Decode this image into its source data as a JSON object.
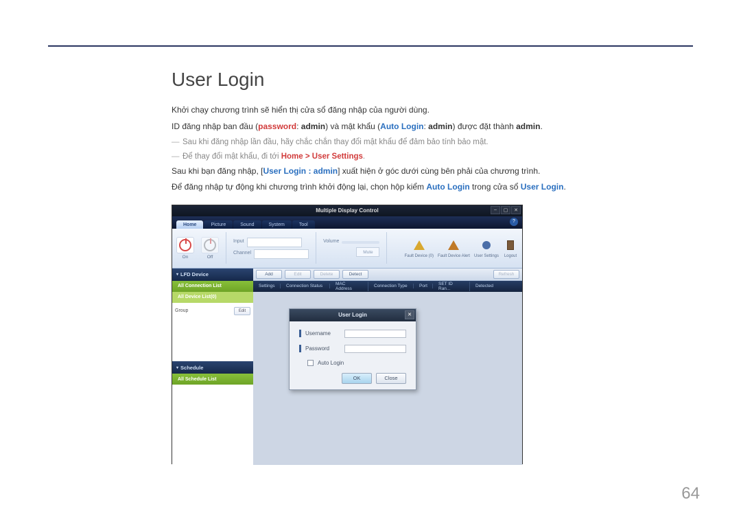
{
  "page_number": "64",
  "heading": "User Login",
  "para1": "Khởi chạy chương trình sẽ hiển thị cửa sổ đăng nhập của người dùng.",
  "para2_a": "ID đăng nhập ban đầu (",
  "para2_pw": "password",
  "para2_b": ": ",
  "para2_admin1": "admin",
  "para2_c": ") và mật khẩu (",
  "para2_al": "Auto Login",
  "para2_d": ": ",
  "para2_admin2": "admin",
  "para2_e": ") được đặt thành ",
  "para2_admin3": "admin",
  "para2_f": ".",
  "note1": "Sau khi đăng nhập lần đầu, hãy chắc chắn thay đổi mật khẩu để đảm bảo tính bảo mật.",
  "note2_a": "Để thay đổi mật khẩu, đi tới ",
  "note2_home": "Home",
  "note2_sep": " > ",
  "note2_us": "User Settings",
  "note2_end": ".",
  "para3_a": "Sau khi bạn đăng nhập, [",
  "para3_login": "User Login : admin",
  "para3_b": "] xuất hiện ở góc dưới cùng bên phải của chương trình.",
  "para4_a": "Để đăng nhập tự động khi chương trình khởi động lại, chọn hộp kiểm ",
  "para4_al": "Auto Login",
  "para4_b": " trong cửa sổ ",
  "para4_ul": "User Login",
  "para4_c": ".",
  "app": {
    "title": "Multiple Display Control",
    "tabs": [
      "Home",
      "Picture",
      "Sound",
      "System",
      "Tool"
    ],
    "ribbon": {
      "on": "On",
      "off": "Off",
      "input": "Input",
      "channel": "Channel",
      "volume": "Volume",
      "mute": "Mute",
      "fault_device": "Fault Device (0)",
      "fault_alert": "Fault Device Alert",
      "user_settings": "User Settings",
      "logout": "Logout"
    },
    "sidebar": {
      "lfd": "LFD Device",
      "conn_list": "All Connection List",
      "dev_list": "All Device List(0)",
      "group": "Group",
      "edit": "Edit",
      "schedule": "Schedule",
      "sched_list": "All Schedule List"
    },
    "workspace": {
      "add": "Add",
      "edit": "Edit",
      "delete": "Delete",
      "detect": "Detect",
      "refresh": "Refresh",
      "cols": [
        "Settings",
        "Connection Status",
        "MAC Address",
        "Connection Type",
        "Port",
        "SET ID Ran...",
        "Detected"
      ]
    },
    "login": {
      "title": "User Login",
      "username": "Username",
      "password": "Password",
      "auto": "Auto Login",
      "ok": "OK",
      "close": "Close"
    }
  }
}
